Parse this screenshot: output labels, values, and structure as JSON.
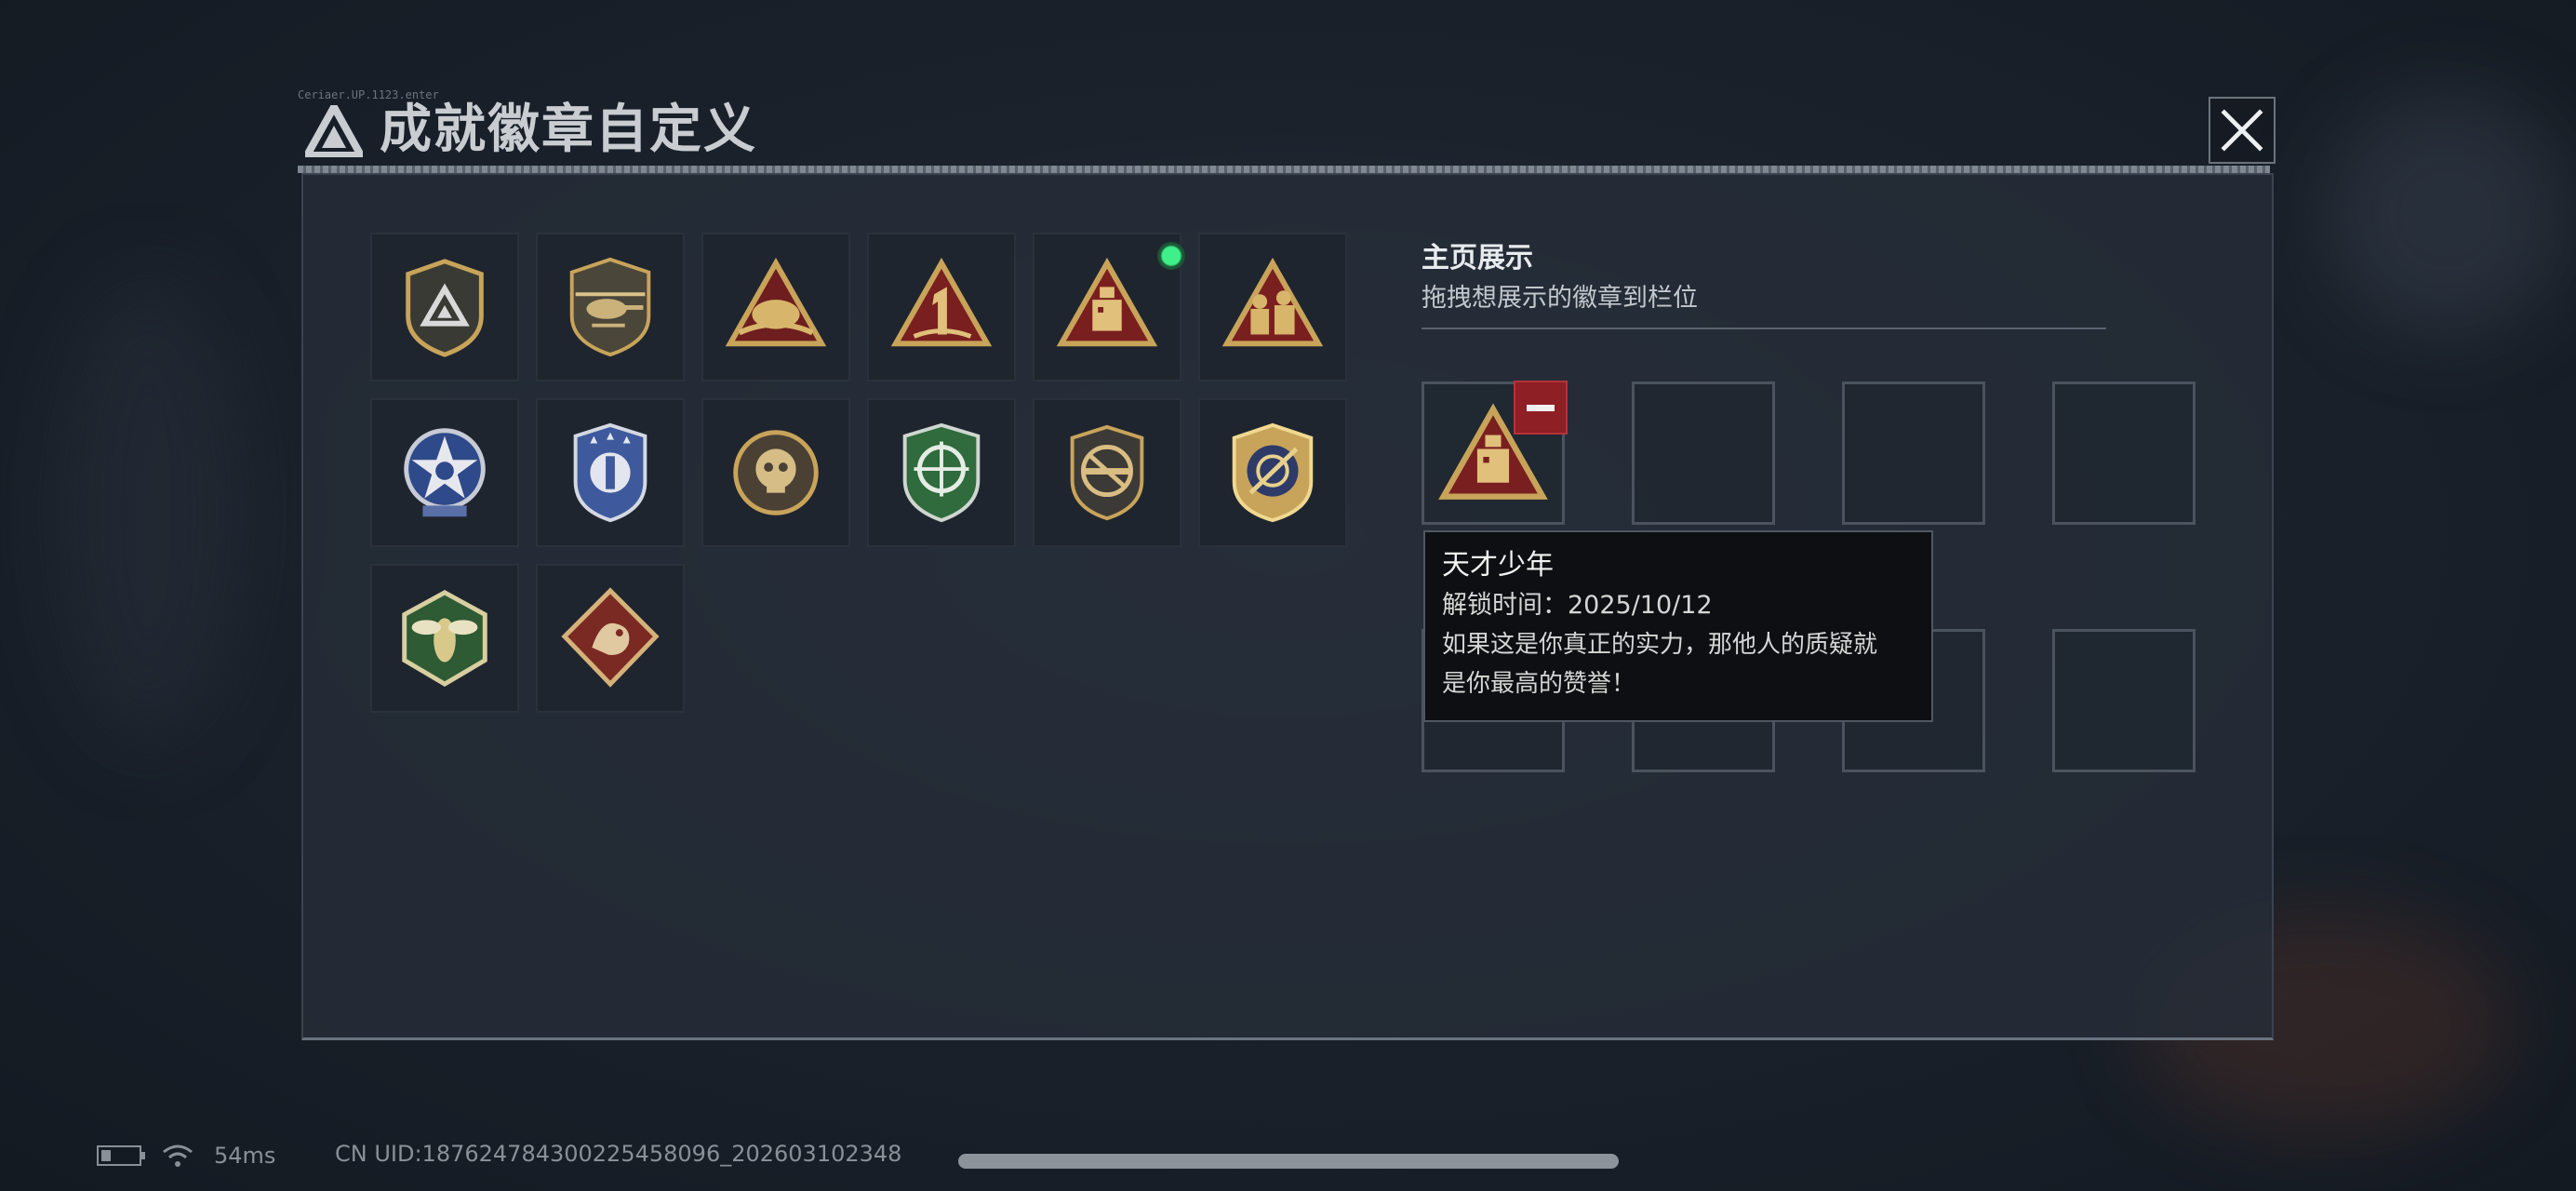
{
  "header": {
    "title": "成就徽章自定义",
    "deco_text": "Ceriaer.UP.1123.enter"
  },
  "badges": [
    {
      "icon": "shield-emblem-icon",
      "new": false
    },
    {
      "icon": "helicopter-badge-icon",
      "new": false
    },
    {
      "icon": "triangle-wings-badge-icon",
      "new": false
    },
    {
      "icon": "triangle-number-one-badge-icon",
      "new": false
    },
    {
      "icon": "triangle-robot-badge-icon",
      "new": true
    },
    {
      "icon": "triangle-soldiers-badge-icon",
      "new": false
    },
    {
      "icon": "star-medal-badge-icon",
      "new": false
    },
    {
      "icon": "blue-shield-badge-icon",
      "new": false
    },
    {
      "icon": "skull-circle-badge-icon",
      "new": false
    },
    {
      "icon": "green-crosshair-shield-icon",
      "new": false
    },
    {
      "icon": "no-rifle-shield-icon",
      "new": false
    },
    {
      "icon": "gold-target-shield-icon",
      "new": false
    },
    {
      "icon": "hornet-hexagon-badge-icon",
      "new": false
    },
    {
      "icon": "dragon-diamond-badge-icon",
      "new": false
    }
  ],
  "showcase": {
    "title": "主页展示",
    "subtitle": "拖拽想展示的徽章到栏位",
    "slots_filled": 1,
    "slot_count": 8
  },
  "tooltip": {
    "name": "天才少年",
    "unlock_time": "解锁时间：2025/10/12",
    "description_line1": "如果这是你真正的实力，那他人的质疑就",
    "description_line2": "是你最高的赞誉！"
  },
  "status": {
    "ping": "54ms",
    "uid": "CN UID:18762478430022545809​6_202603102348"
  },
  "colors": {
    "gold": "#c8a45a",
    "red": "#8e1f24",
    "blue": "#3e5a9c",
    "green": "#2f6b3c",
    "new_dot": "#3ff08a"
  }
}
